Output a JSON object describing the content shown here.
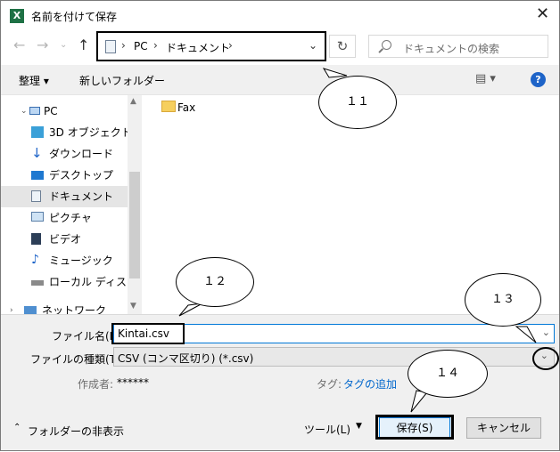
{
  "window": {
    "title": "名前を付けて保存",
    "app_icon": "X"
  },
  "address": {
    "crumbs": [
      "PC",
      "ドキュメント"
    ]
  },
  "search": {
    "placeholder": "ドキュメントの検索"
  },
  "toolbar": {
    "organize": "整理 ▾",
    "new_folder": "新しいフォルダー",
    "view_glyph": "▤ ▾",
    "help": "?"
  },
  "nav": {
    "items": [
      {
        "label": "PC",
        "icon": "pc-icon"
      },
      {
        "label": "3D オブジェクト",
        "icon": "3d-objects-icon"
      },
      {
        "label": "ダウンロード",
        "icon": "download-icon"
      },
      {
        "label": "デスクトップ",
        "icon": "desktop-icon"
      },
      {
        "label": "ドキュメント",
        "icon": "documents-icon",
        "selected": true
      },
      {
        "label": "ピクチャ",
        "icon": "pictures-icon"
      },
      {
        "label": "ビデオ",
        "icon": "video-icon"
      },
      {
        "label": "ミュージック",
        "icon": "music-icon"
      },
      {
        "label": "ローカル ディスク (C",
        "icon": "disk-icon"
      },
      {
        "label": "ネットワーク",
        "icon": "network-icon"
      }
    ]
  },
  "content": {
    "folders": [
      "Fax"
    ]
  },
  "form": {
    "filename_label": "ファイル名(N):",
    "filename_value": "Kintai.csv",
    "filetype_label": "ファイルの種類(T):",
    "filetype_value": "CSV (コンマ区切り) (*.csv)",
    "author_label": "作成者:",
    "author_value": "******",
    "tags_label": "タグ:",
    "tags_value": "タグの追加"
  },
  "footer": {
    "hide_folders": "フォルダーの非表示",
    "tools": "ツール(L)",
    "save": "保存(S)",
    "cancel": "キャンセル"
  },
  "callouts": [
    "１１",
    "１２",
    "１３",
    "１４"
  ]
}
